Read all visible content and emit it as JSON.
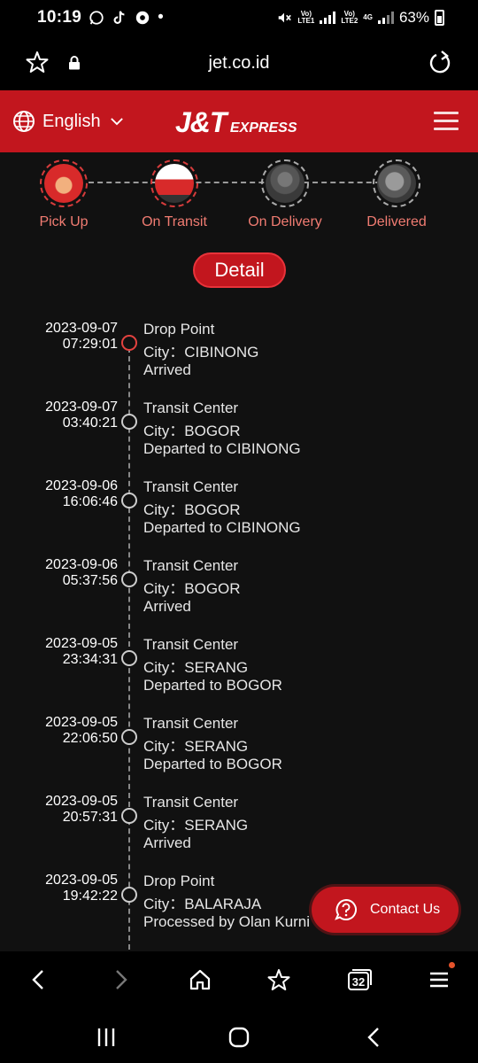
{
  "status_bar": {
    "time": "10:19",
    "dot": "•",
    "battery": "63%",
    "lte1": "LTE1",
    "lte2": "LTE2",
    "vol1": "Vo)",
    "vol2": "Vo)",
    "net": "4G"
  },
  "browser": {
    "url": "jet.co.id",
    "tabs_count": "32"
  },
  "header": {
    "language": "English",
    "logo_text": "J&T",
    "logo_sub": "EXPRESS",
    "brand_color": "#c2161e"
  },
  "progress_steps": [
    {
      "label": "Pick Up",
      "icon": "pickup-icon"
    },
    {
      "label": "On Transit",
      "icon": "truck-icon"
    },
    {
      "label": "On Delivery",
      "icon": "scooter-icon"
    },
    {
      "label": "Delivered",
      "icon": "package-icon"
    }
  ],
  "detail_button": "Detail",
  "events": [
    {
      "date": "2023-09-07",
      "time": "07:29:01",
      "location": "Drop Point",
      "city": "City：CIBINONG",
      "status": "Arrived"
    },
    {
      "date": "2023-09-07",
      "time": "03:40:21",
      "location": "Transit Center",
      "city": "City：BOGOR",
      "status": "Departed to CIBINONG"
    },
    {
      "date": "2023-09-06",
      "time": "16:06:46",
      "location": "Transit Center",
      "city": "City：BOGOR",
      "status": "Departed to CIBINONG"
    },
    {
      "date": "2023-09-06",
      "time": "05:37:56",
      "location": "Transit Center",
      "city": "City：BOGOR",
      "status": "Arrived"
    },
    {
      "date": "2023-09-05",
      "time": "23:34:31",
      "location": "Transit Center",
      "city": "City：SERANG",
      "status": "Departed to BOGOR"
    },
    {
      "date": "2023-09-05",
      "time": "22:06:50",
      "location": "Transit Center",
      "city": "City：SERANG",
      "status": "Departed to BOGOR"
    },
    {
      "date": "2023-09-05",
      "time": "20:57:31",
      "location": "Transit Center",
      "city": "City：SERANG",
      "status": "Arrived"
    },
    {
      "date": "2023-09-05",
      "time": "19:42:22",
      "location": "Drop Point",
      "city": "City：BALARAJA",
      "status": "Processed by Olan Kurni"
    }
  ],
  "contact_button": "Contact Us"
}
